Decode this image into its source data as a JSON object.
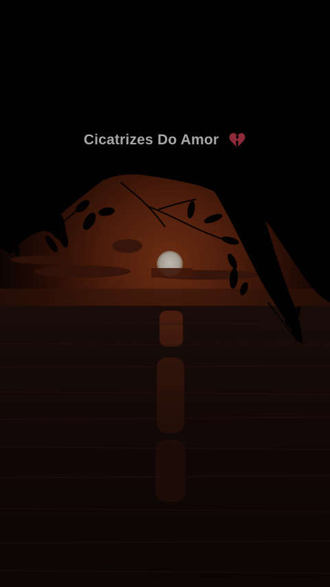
{
  "caption": {
    "text": "Cicatrizes Do Amor",
    "emoji_icon": "broken-heart-icon"
  },
  "colors": {
    "sky_glow": "#6b2a12",
    "sky_dark": "#1a0805",
    "sun": "#c9c2b8",
    "water": "#150a08",
    "foliage": "#030202",
    "caption_text": "#a8a8a8",
    "heart": "#8e2a3a"
  }
}
